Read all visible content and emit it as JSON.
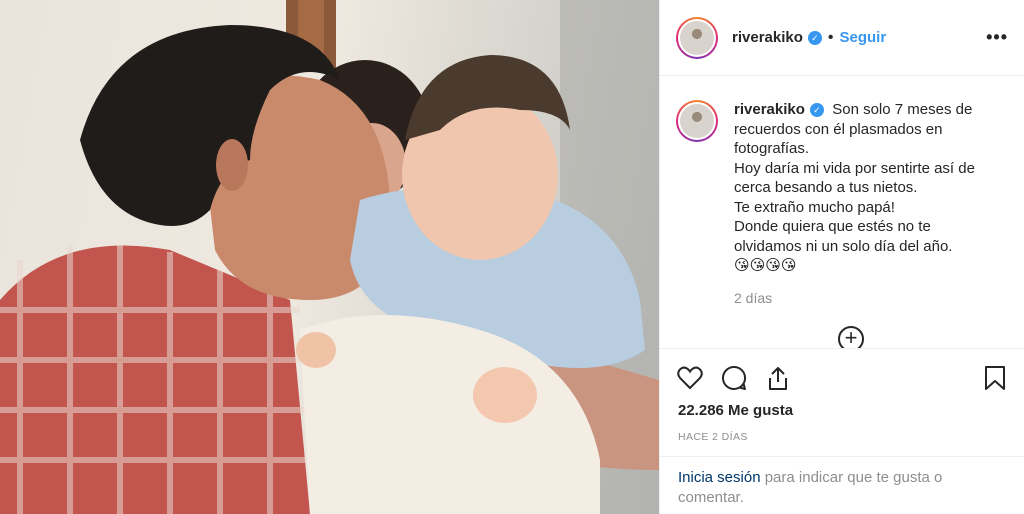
{
  "post": {
    "username": "riverakiko",
    "follow_label": "Seguir",
    "more_label": "•••",
    "caption": "Son solo 7 meses de recuerdos con él plasmados en fotografías.\nHoy daría mi vida por sentirte así de cerca besando a tus nietos.\nTe extraño mucho papá!\nDonde quiera que estés no te olvidamos ni un solo día del año.\n😘😘😘😘",
    "comment_time": "2 días",
    "load_more_symbol": "+",
    "likes": "22.286 Me gusta",
    "date": "HACE 2 DÍAS",
    "login_link": "Inicia sesión",
    "login_text": " para indicar que te gusta o comentar."
  },
  "icons": {
    "verified": "verified-badge-icon",
    "like": "heart-icon",
    "comment": "comment-bubble-icon",
    "share": "share-icon",
    "save": "bookmark-icon"
  },
  "colors": {
    "accent": "#3897f0",
    "text": "#262626",
    "muted": "#8e8e8e",
    "border": "#efefef"
  }
}
